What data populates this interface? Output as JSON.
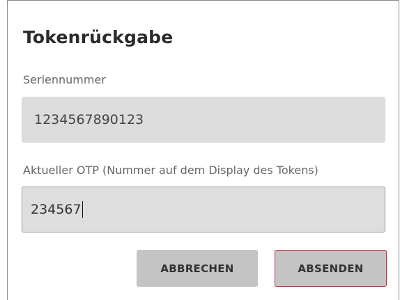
{
  "dialog": {
    "title": "Tokenrückgabe",
    "serial_label": "Seriennummer",
    "serial_value": "1234567890123",
    "otp_label": "Aktueller OTP (Nummer auf dem Display des Tokens)",
    "otp_value": "234567",
    "cancel_label": "ABBRECHEN",
    "submit_label": "ABSENDEN"
  },
  "colors": {
    "field_background": "#dcdcdc",
    "button_background": "#c4c4c4",
    "focus_border": "#d9233c"
  }
}
